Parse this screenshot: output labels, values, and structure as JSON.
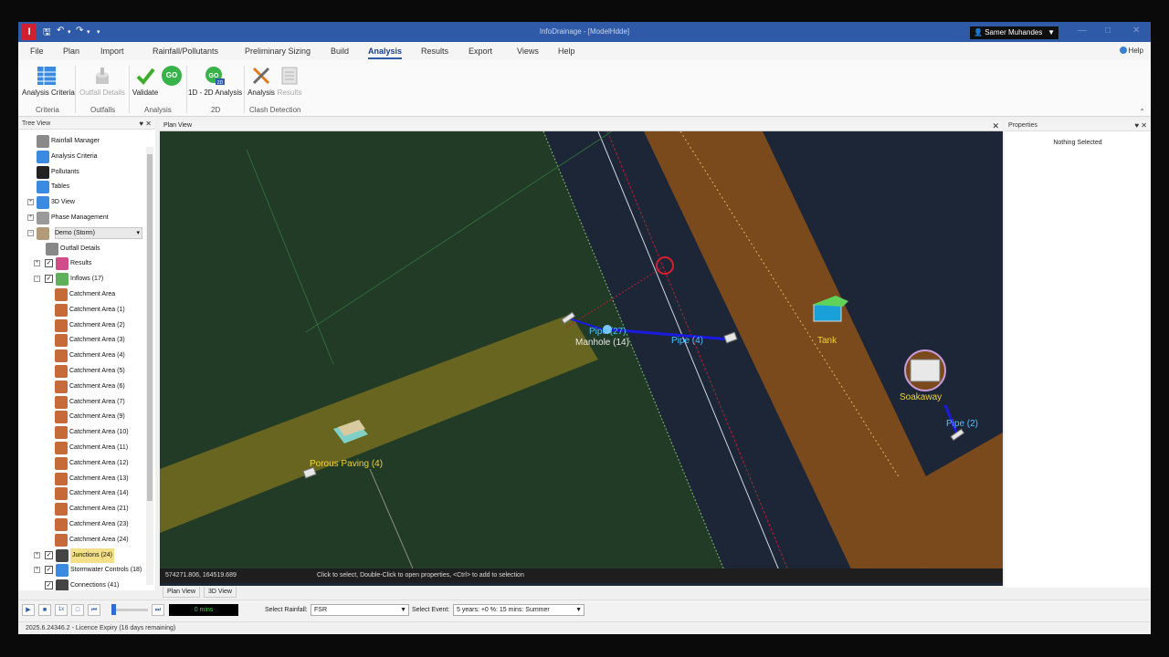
{
  "app": {
    "logo_letter": "I",
    "window_title": "InfoDrainage - [ModelHdde]",
    "user_name": "Samer Muhandes"
  },
  "menu": {
    "tabs": [
      "File",
      "Plan",
      "Import",
      "Rainfall/Pollutants",
      "Preliminary Sizing",
      "Build",
      "Analysis",
      "Results",
      "Export",
      "Views",
      "Help"
    ],
    "active_tab": "Analysis",
    "help_label": "Help"
  },
  "ribbon": {
    "buttons": {
      "analysis_criteria": "Analysis Criteria",
      "outfall_details": "Outfall Details",
      "validate": "Validate",
      "go_label": "GO",
      "analysis_1d2d": "1D - 2D Analysis",
      "clash_analysis": "Analysis",
      "clash_results": "Results"
    },
    "groups": {
      "criteria": "Criteria",
      "outfalls": "Outfalls",
      "analysis": "Analysis",
      "two_d": "2D",
      "clash": "Clash Detection"
    }
  },
  "tree": {
    "header": "Tree View",
    "items": {
      "rainfall_manager": "Rainfall Manager",
      "analysis_criteria": "Analysis Criteria",
      "pollutants": "Pollutants",
      "tables": "Tables",
      "view_3d": "3D View",
      "phase_management": "Phase Management",
      "phase_selected": "Demo (Storm)",
      "outfall_details": "Outfall Details",
      "results": "Results",
      "inflows": "Inflows (17)",
      "catchments": [
        "Catchment Area",
        "Catchment Area (1)",
        "Catchment Area (2)",
        "Catchment Area (3)",
        "Catchment Area (4)",
        "Catchment Area (5)",
        "Catchment Area (6)",
        "Catchment Area (7)",
        "Catchment Area (9)",
        "Catchment Area (10)",
        "Catchment Area (11)",
        "Catchment Area (12)",
        "Catchment Area (13)",
        "Catchment Area (14)",
        "Catchment Area (21)",
        "Catchment Area (23)",
        "Catchment Area (24)"
      ],
      "junctions": "Junctions (24)",
      "stormwater_controls": "Stormwater Controls (18)",
      "connections": "Connections (41)"
    }
  },
  "plan": {
    "header": "Plan View",
    "labels": {
      "pipe_27": "Pipe (27)",
      "manhole_14": "Manhole (14)",
      "pipe_4": "Pipe (4)",
      "tank": "Tank",
      "soakaway": "Soakaway",
      "pipe_2": "Pipe (2)",
      "porous_paving": "Porous Paving (4)"
    },
    "coords": "574271.806, 164519.689",
    "hint": "Click to select, Double-Click to open properties, <Ctrl> to add to selection",
    "tabs": [
      "Plan View",
      "3D View"
    ]
  },
  "properties": {
    "header": "Properties",
    "empty_text": "Nothing Selected"
  },
  "controls": {
    "time": "0 mins",
    "select_rainfall_label": "Select Rainfall:",
    "rainfall_value": "FSR",
    "select_event_label": "Select Event:",
    "event_value": "5 years: +0 %: 15 mins: Summer"
  },
  "footer": {
    "text": "2025.6.24346.2 - Licence Expiry (16 days remaining)"
  },
  "colors": {
    "title_bar": "#2e5aa8",
    "pipe_label": "#4fc3ff",
    "feature_label": "#f1d23a",
    "road_band": "#7a4a1c",
    "green_area": "#213b27"
  }
}
